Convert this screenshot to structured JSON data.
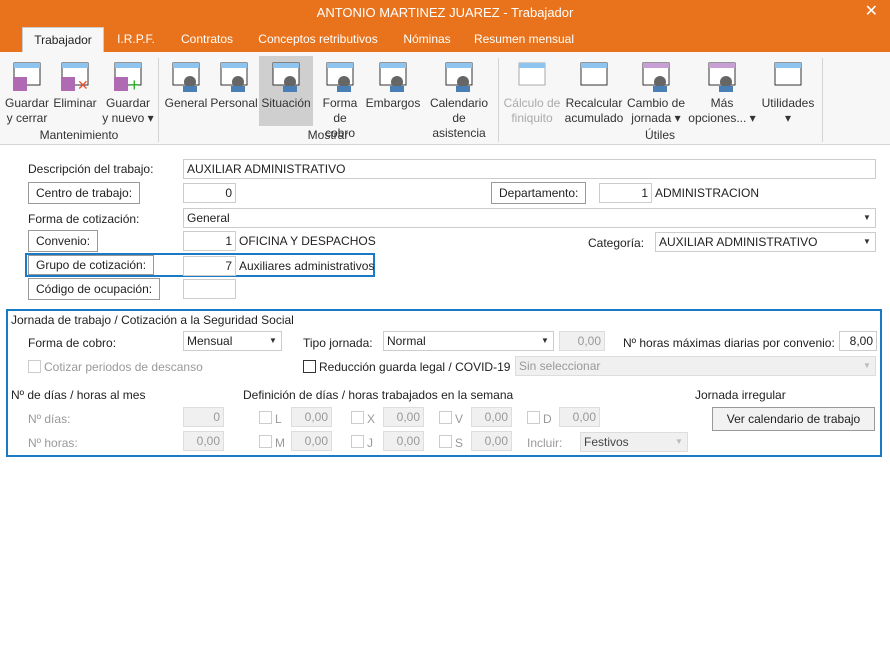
{
  "window": {
    "title": "ANTONIO MARTINEZ JUAREZ - Trabajador",
    "close": "✕"
  },
  "tabs": [
    {
      "label": "Trabajador"
    },
    {
      "label": "I.R.P.F."
    },
    {
      "label": "Contratos"
    },
    {
      "label": "Conceptos retributivos"
    },
    {
      "label": "Nóminas"
    },
    {
      "label": "Resumen mensual"
    }
  ],
  "ribbon": {
    "groups": [
      {
        "label": "Mantenimiento"
      },
      {
        "label": "Mostrar"
      },
      {
        "label": "Útiles"
      }
    ],
    "buttons": [
      {
        "l1": "Guardar",
        "l2": "y cerrar",
        "icon": "save-close-icon"
      },
      {
        "l1": "Eliminar",
        "l2": "",
        "icon": "delete-icon"
      },
      {
        "l1": "Guardar",
        "l2": "y nuevo ▾",
        "icon": "save-new-icon"
      },
      {
        "l1": "General",
        "l2": "",
        "icon": "general-icon"
      },
      {
        "l1": "Personal",
        "l2": "",
        "icon": "personal-icon"
      },
      {
        "l1": "Situación",
        "l2": "",
        "icon": "situacion-icon"
      },
      {
        "l1": "Forma",
        "l2": "de cobro",
        "icon": "payment-icon"
      },
      {
        "l1": "Embargos",
        "l2": "",
        "icon": "embargos-icon"
      },
      {
        "l1": "Calendario",
        "l2": "de asistencia",
        "icon": "calendar-icon"
      },
      {
        "l1": "Cálculo de",
        "l2": "finiquito",
        "icon": "calculator-icon"
      },
      {
        "l1": "Recalcular",
        "l2": "acumulado",
        "icon": "sum-icon"
      },
      {
        "l1": "Cambio de",
        "l2": "jornada ▾",
        "icon": "change-schedule-icon"
      },
      {
        "l1": "Más",
        "l2": "opciones... ▾",
        "icon": "more-options-icon"
      },
      {
        "l1": "Utilidades",
        "l2": "▾",
        "icon": "utilities-icon"
      }
    ]
  },
  "form": {
    "descripcion_label": "Descripción del trabajo:",
    "descripcion": "AUXILIAR ADMINISTRATIVO",
    "centro_label": "Centro de trabajo:",
    "centro": "0",
    "departamento_label": "Departamento:",
    "departamento_code": "1",
    "departamento": "ADMINISTRACION",
    "forma_cot_label": "Forma de cotización:",
    "forma_cot": "General",
    "convenio_label": "Convenio:",
    "convenio_code": "1",
    "convenio": "OFICINA Y DESPACHOS",
    "categoria_label": "Categoría:",
    "categoria": "AUXILIAR ADMINISTRATIVO",
    "grupo_label": "Grupo de cotización:",
    "grupo_code": "7",
    "grupo": "Auxiliares administrativos",
    "ocupacion_label": "Código de ocupación:",
    "ocupacion": ""
  },
  "jornada": {
    "title": "Jornada de trabajo / Cotización a la Seguridad Social",
    "forma_cobro_label": "Forma de cobro:",
    "forma_cobro": "Mensual",
    "tipo_label": "Tipo jornada:",
    "tipo": "Normal",
    "tipo_value": "0,00",
    "horas_max_label": "Nº horas máximas diarias por convenio:",
    "horas_max": "8,00",
    "cotizar_label": "Cotizar periodos de descanso",
    "reduccion_label": "Reducción guarda legal / COVID-19",
    "reduccion_sel": "Sin seleccionar",
    "mes_title": "Nº de días / horas al mes",
    "dias_label": "Nº días:",
    "dias": "0",
    "horas_label": "Nº horas:",
    "horas": "0,00",
    "semana_title": "Definición de días / horas trabajados en la semana",
    "days": [
      {
        "d": "L",
        "v": "0,00"
      },
      {
        "d": "X",
        "v": "0,00"
      },
      {
        "d": "V",
        "v": "0,00"
      },
      {
        "d": "D",
        "v": "0,00"
      },
      {
        "d": "M",
        "v": "0,00"
      },
      {
        "d": "J",
        "v": "0,00"
      },
      {
        "d": "S",
        "v": "0,00"
      }
    ],
    "incluir_label": "Incluir:",
    "incluir": "Festivos",
    "irregular_title": "Jornada irregular",
    "calendario_btn": "Ver calendario de trabajo"
  }
}
